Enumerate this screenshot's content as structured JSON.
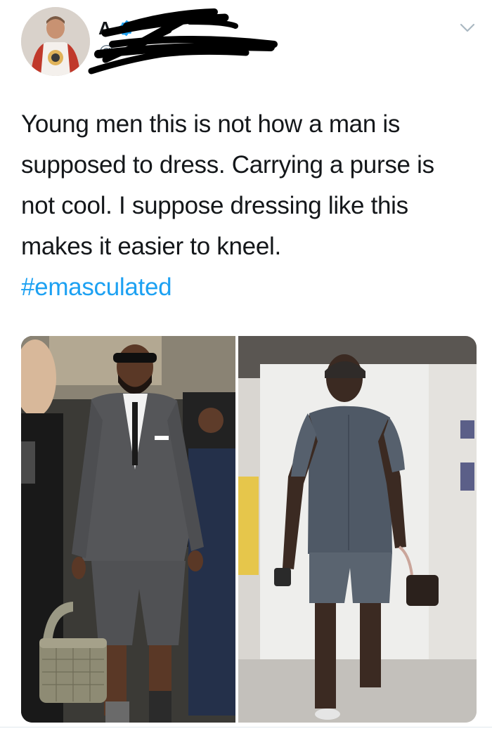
{
  "tweet": {
    "author": {
      "display_name": "A",
      "handle": "@",
      "verified": true,
      "avatar": "profile-photo"
    },
    "menu_icon": "chevron-down-icon",
    "text_lines": [
      "Young men this is not how a man is",
      "supposed to dress. Carrying a purse is",
      "not cool. I suppose dressing like this",
      "makes it easier to kneel."
    ],
    "hashtag": "#emasculated",
    "media": [
      {
        "description": "photo-left",
        "kind": "image"
      },
      {
        "description": "photo-right",
        "kind": "image"
      }
    ]
  },
  "colors": {
    "text": "#14171a",
    "secondary_text": "#657786",
    "link": "#1da1f2",
    "verified_badge": "#1da1f2",
    "redaction_marker": "#000000"
  }
}
